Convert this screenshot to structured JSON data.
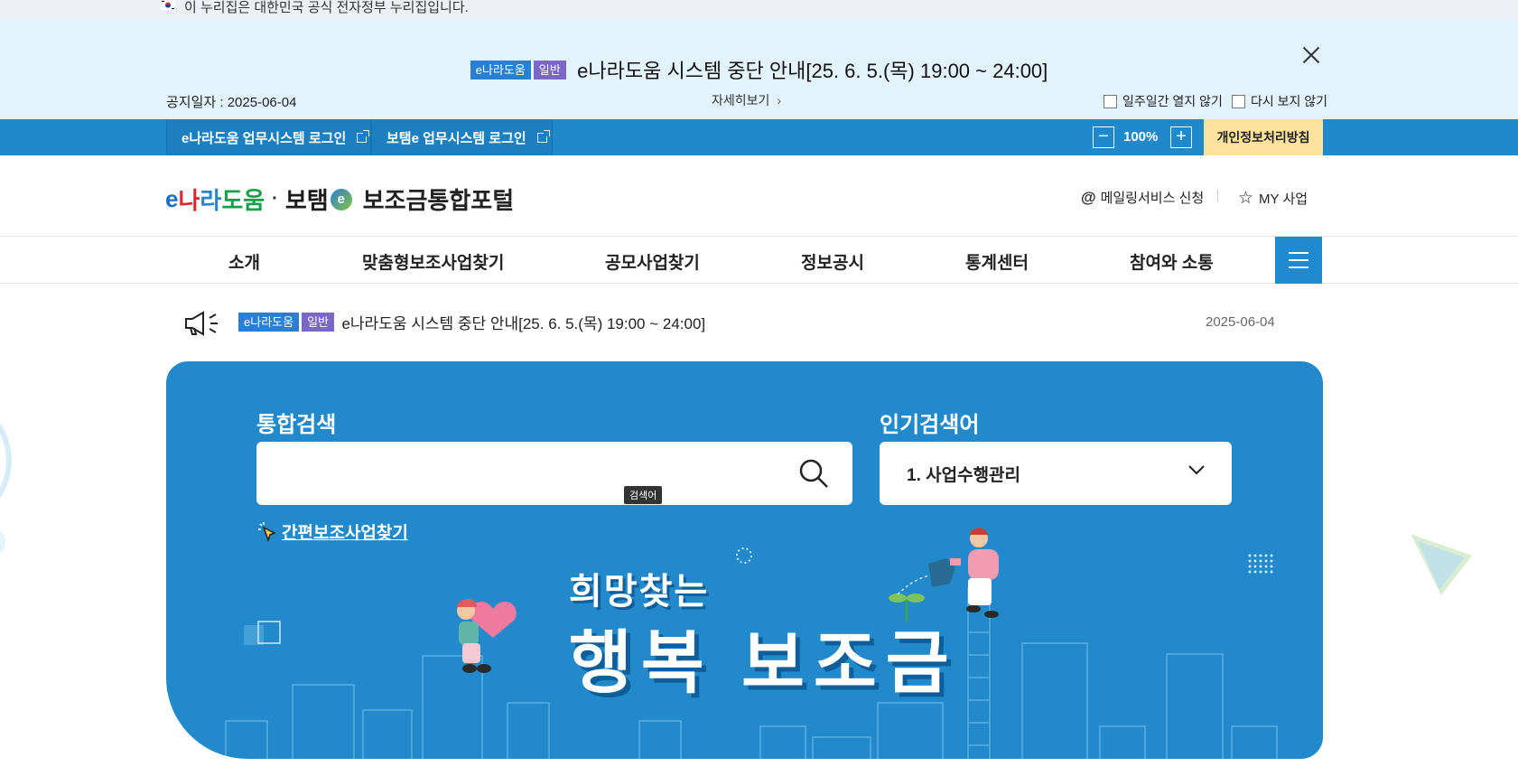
{
  "gov_banner": {
    "text": "이 누리집은 대한민국 공식 전자정부 누리집입니다."
  },
  "notice": {
    "badge_site": "e나라도움",
    "badge_type": "일반",
    "title": "e나라도움 시스템 중단 안내[25. 6. 5.(목) 19:00 ~ 24:00]",
    "date": "공지일자 : 2025-06-04",
    "detail_label": "자세히보기",
    "opt_week": "일주일간 열지 않기",
    "opt_never": "다시 보지 않기"
  },
  "util_bar": {
    "login1": "e나라도움 업무시스템 로그인",
    "login2": "보탬e 업무시스템 로그인",
    "zoom": "100%",
    "privacy": "개인정보처리방침"
  },
  "header": {
    "logo_e": "e",
    "logo_na": "나",
    "logo_ra": "라",
    "logo_do": "도움",
    "logo_dot": "·",
    "logo_botaem": "보탬",
    "logo_portal": "보조금통합포털",
    "mailing": "메일링서비스 신청",
    "my": "MY 사업"
  },
  "gnb": [
    "소개",
    "맞춤형보조사업찾기",
    "공모사업찾기",
    "정보공시",
    "통계센터",
    "참여와 소통"
  ],
  "news": {
    "badge_site": "e나라도움",
    "badge_type": "일반",
    "text": "e나라도움 시스템 중단 안내[25. 6. 5.(목) 19:00 ~ 24:00]",
    "date": "2025-06-04"
  },
  "hero": {
    "search_label": "통합검색",
    "search_value": "",
    "tooltip": "검색어",
    "popular_label": "인기검색어",
    "popular_selected": "1. 사업수행관리",
    "quick_link": "간편보조사업찾기",
    "slogan_small": "희망찾는",
    "slogan_big": "행복 보조금"
  },
  "colors": {
    "primary_blue": "#2089c9",
    "hero_blue": "#2289cb",
    "notice_bg": "#e3f3fc",
    "privacy_bg": "#ffe29c",
    "badge_blue": "#2a7fd0",
    "badge_purple": "#7a67c7"
  }
}
